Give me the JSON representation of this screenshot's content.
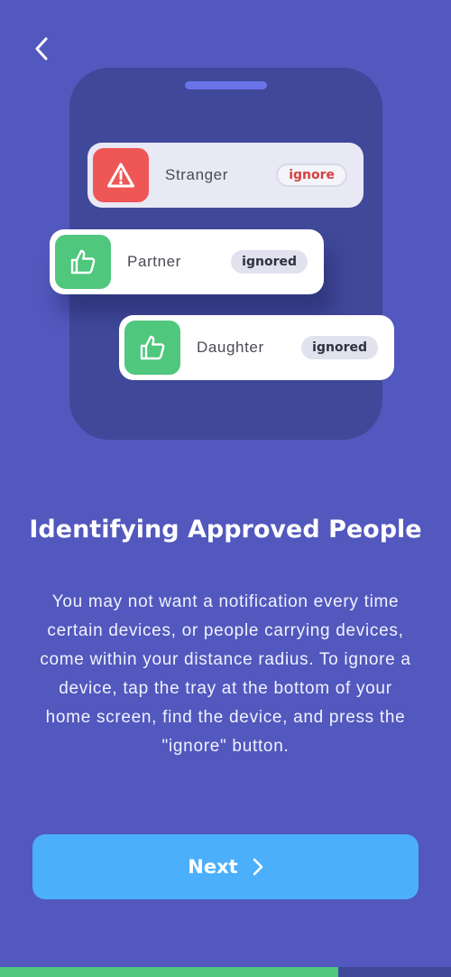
{
  "nav": {
    "back_icon": "chevron-left-icon"
  },
  "illustration": {
    "cards": [
      {
        "name": "Stranger",
        "status": "ignore",
        "icon": "warning-triangle-icon",
        "color": "#ef5656"
      },
      {
        "name": "Partner",
        "status": "ignored",
        "icon": "thumbs-up-icon",
        "color": "#4fc77d"
      },
      {
        "name": "Daughter",
        "status": "ignored",
        "icon": "thumbs-up-icon",
        "color": "#4fc77d"
      }
    ]
  },
  "content": {
    "title": "Identifying Approved People",
    "body": "You may not want a notification every time certain devices, or people carrying devices, come within your distance radius. To ignore a device, tap the tray at the bottom of your home screen, find the device, and press the \"ignore\" button."
  },
  "actions": {
    "next_label": "Next",
    "next_icon": "chevron-right-icon"
  },
  "progress": {
    "fraction": 0.75
  },
  "colors": {
    "background": "#5258bd",
    "button": "#4caffb",
    "progress": "#4fc77d",
    "danger": "#ef5656"
  }
}
